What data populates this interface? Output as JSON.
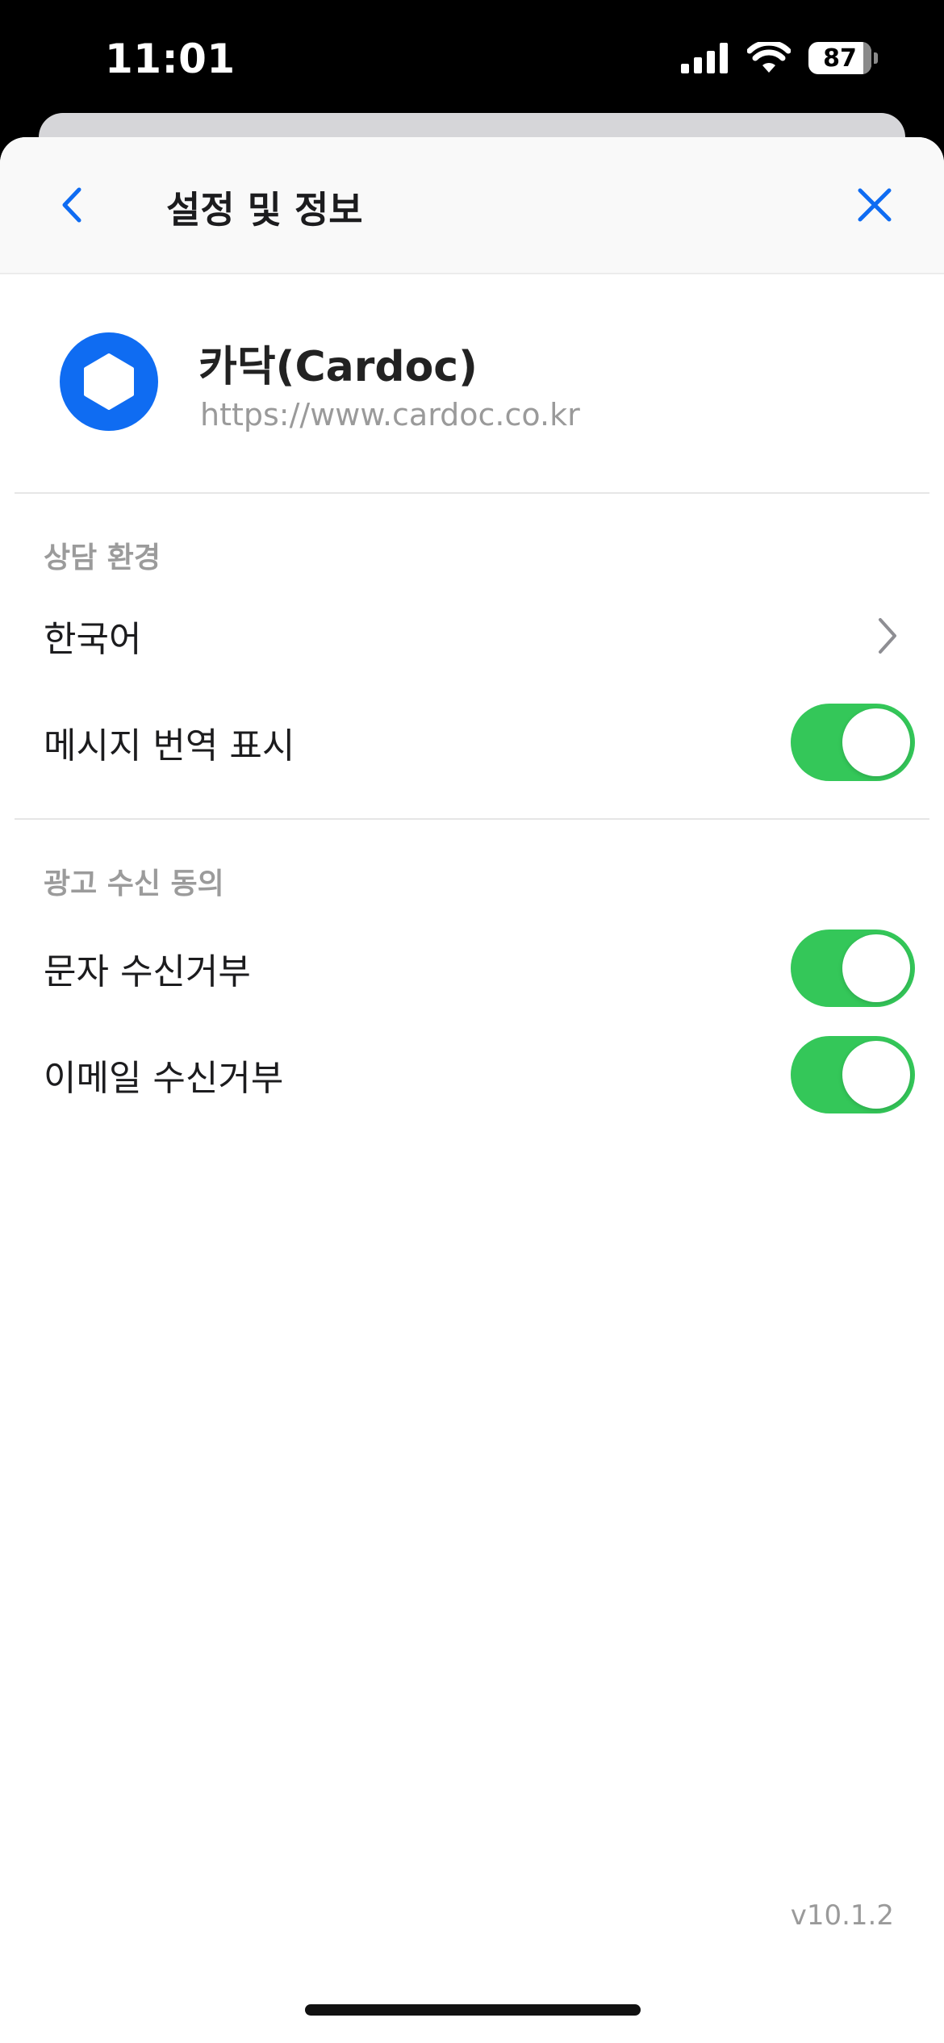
{
  "status_bar": {
    "time": "11:01",
    "battery": "87",
    "icons": [
      "cellular-signal-icon",
      "wifi-icon",
      "battery-icon"
    ]
  },
  "nav": {
    "title": "설정 및 정보",
    "back_icon": "chevron-left-icon",
    "close_icon": "close-icon"
  },
  "company": {
    "name": "카닥(Cardoc)",
    "url": "https://www.cardoc.co.kr",
    "logo_icon": "hexagon-logo-icon"
  },
  "sections": [
    {
      "title": "상담 환경",
      "rows": [
        {
          "label": "한국어",
          "control": "chevron-right-icon"
        },
        {
          "label": "메시지 번역 표시",
          "control": "toggle",
          "on": true
        }
      ]
    },
    {
      "title": "광고 수신 동의",
      "rows": [
        {
          "label": "문자 수신거부",
          "control": "toggle",
          "on": true
        },
        {
          "label": "이메일 수신거부",
          "control": "toggle",
          "on": true
        }
      ]
    }
  ],
  "version": "v10.1.2",
  "colors": {
    "accent_blue": "#0f6cf2",
    "toggle_on": "#34c759",
    "section_title": "#9b9b9b",
    "url_gray": "#9a9a9a"
  }
}
